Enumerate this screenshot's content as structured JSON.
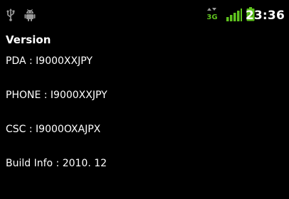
{
  "status_bar": {
    "time": "23:36",
    "network_label": "3G",
    "colors": {
      "background": "#000000",
      "icon_gray": "#9a9a9a",
      "signal_green": "#5fc31e"
    },
    "icons": [
      "usb-icon",
      "android-debug-icon",
      "3g-data-icon",
      "signal-strength-icon",
      "battery-icon"
    ]
  },
  "version": {
    "title": "Version",
    "pda": "PDA : I9000XXJPY",
    "phone": "PHONE : I9000XXJPY",
    "csc": "CSC : I9000OXAJPX",
    "build_info": "Build Info : 2010. 12"
  }
}
